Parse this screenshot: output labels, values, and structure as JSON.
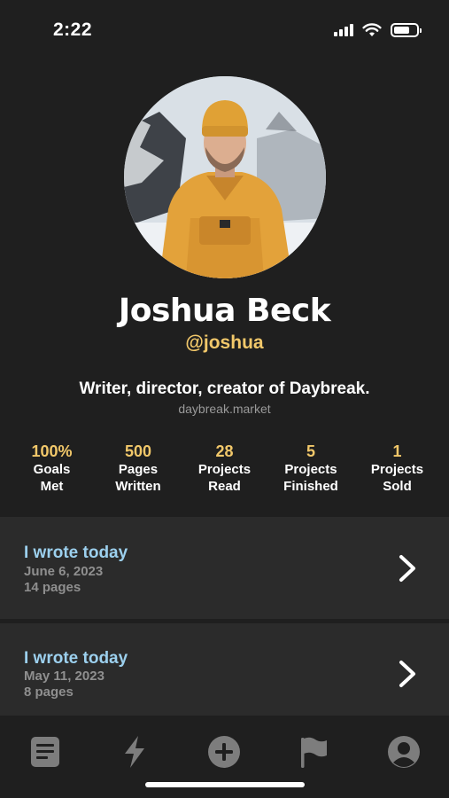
{
  "status_bar": {
    "time": "2:22",
    "battery_level": 0.7
  },
  "profile": {
    "name": "Joshua Beck",
    "handle": "@joshua",
    "bio": "Writer, director, creator of Daybreak.",
    "link": "daybreak.market"
  },
  "stats": [
    {
      "value": "100%",
      "label_line1": "Goals",
      "label_line2": "Met"
    },
    {
      "value": "500",
      "label_line1": "Pages",
      "label_line2": "Written"
    },
    {
      "value": "28",
      "label_line1": "Projects",
      "label_line2": "Read"
    },
    {
      "value": "5",
      "label_line1": "Projects",
      "label_line2": "Finished"
    },
    {
      "value": "1",
      "label_line1": "Projects",
      "label_line2": "Sold"
    }
  ],
  "activity": [
    {
      "title": "I wrote today",
      "date": "June 6, 2023",
      "pages": "14 pages"
    },
    {
      "title": "I wrote today",
      "date": "May 11, 2023",
      "pages": "8 pages"
    }
  ],
  "tab_bar": {
    "icons": [
      "document-icon",
      "lightning-icon",
      "plus-circle-icon",
      "flag-icon",
      "profile-icon"
    ]
  },
  "colors": {
    "background": "#1f1f1f",
    "card": "#2b2b2b",
    "accent_gold": "#f2c86a",
    "accent_blue": "#9cd0ee",
    "muted_text": "#8f8f8f",
    "icon_gray": "#7d7d7d"
  }
}
